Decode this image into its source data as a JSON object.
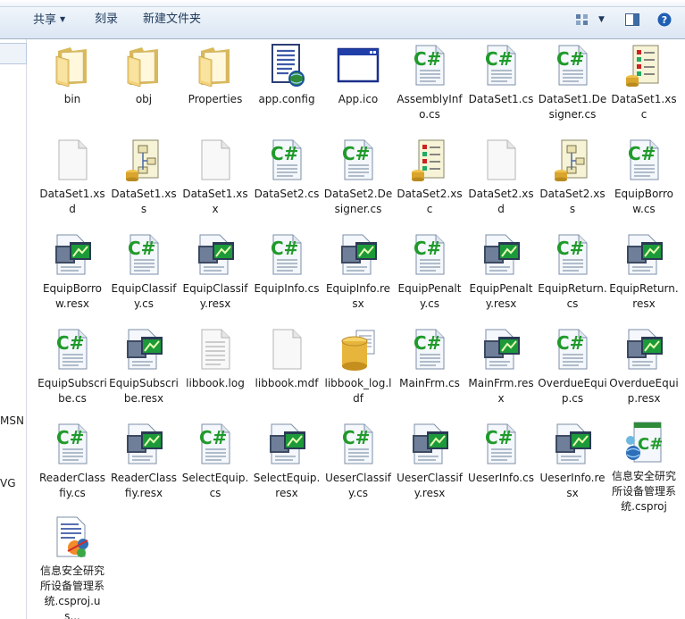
{
  "toolbar": {
    "share_label": "共享",
    "burn_label": "刻录",
    "new_folder_label": "新建文件夹"
  },
  "nav": {
    "items": [
      "MSN",
      "VG"
    ]
  },
  "files": [
    {
      "name": "bin",
      "icon": "folder-icon"
    },
    {
      "name": "obj",
      "icon": "folder-icon"
    },
    {
      "name": "Properties",
      "icon": "folder-icon"
    },
    {
      "name": "app.config",
      "icon": "config-file-icon"
    },
    {
      "name": "App.ico",
      "icon": "ico-file-icon"
    },
    {
      "name": "AssemblyInfo.cs",
      "icon": "csharp-file-icon"
    },
    {
      "name": "DataSet1.cs",
      "icon": "csharp-file-icon"
    },
    {
      "name": "DataSet1.Designer.cs",
      "icon": "csharp-file-icon"
    },
    {
      "name": "DataSet1.xsc",
      "icon": "xsc-file-icon"
    },
    {
      "name": "DataSet1.xsd",
      "icon": "blank-file-icon"
    },
    {
      "name": "DataSet1.xss",
      "icon": "dataset-file-icon"
    },
    {
      "name": "DataSet1.xsx",
      "icon": "blank-file-icon"
    },
    {
      "name": "DataSet2.cs",
      "icon": "csharp-file-icon"
    },
    {
      "name": "DataSet2.Designer.cs",
      "icon": "csharp-file-icon"
    },
    {
      "name": "DataSet2.xsc",
      "icon": "xsc-file-icon"
    },
    {
      "name": "DataSet2.xsd",
      "icon": "blank-file-icon"
    },
    {
      "name": "DataSet2.xss",
      "icon": "dataset-file-icon"
    },
    {
      "name": "EquipBorrow.cs",
      "icon": "csharp-file-icon"
    },
    {
      "name": "EquipBorrow.resx",
      "icon": "resx-file-icon"
    },
    {
      "name": "EquipClassify.cs",
      "icon": "csharp-file-icon"
    },
    {
      "name": "EquipClassify.resx",
      "icon": "resx-file-icon"
    },
    {
      "name": "EquipInfo.cs",
      "icon": "csharp-file-icon"
    },
    {
      "name": "EquipInfo.resx",
      "icon": "resx-file-icon"
    },
    {
      "name": "EquipPenalty.cs",
      "icon": "csharp-file-icon"
    },
    {
      "name": "EquipPenalty.resx",
      "icon": "resx-file-icon"
    },
    {
      "name": "EquipReturn.cs",
      "icon": "csharp-file-icon"
    },
    {
      "name": "EquipReturn.resx",
      "icon": "resx-file-icon"
    },
    {
      "name": "EquipSubscribe.cs",
      "icon": "csharp-file-icon"
    },
    {
      "name": "EquipSubscribe.resx",
      "icon": "resx-file-icon"
    },
    {
      "name": "libbook.log",
      "icon": "log-file-icon"
    },
    {
      "name": "libbook.mdf",
      "icon": "blank-file-icon"
    },
    {
      "name": "libbook_log.ldf",
      "icon": "database-file-icon"
    },
    {
      "name": "MainFrm.cs",
      "icon": "csharp-file-icon"
    },
    {
      "name": "MainFrm.resx",
      "icon": "resx-file-icon"
    },
    {
      "name": "OverdueEquip.cs",
      "icon": "csharp-file-icon"
    },
    {
      "name": "OverdueEquip.resx",
      "icon": "resx-file-icon"
    },
    {
      "name": "ReaderClassfiy.cs",
      "icon": "csharp-file-icon"
    },
    {
      "name": "ReaderClassfiy.resx",
      "icon": "resx-file-icon"
    },
    {
      "name": "SelectEquip.cs",
      "icon": "csharp-file-icon"
    },
    {
      "name": "SelectEquip.resx",
      "icon": "resx-file-icon"
    },
    {
      "name": "UeserClassify.cs",
      "icon": "csharp-file-icon"
    },
    {
      "name": "UeserClassify.resx",
      "icon": "resx-file-icon"
    },
    {
      "name": "UeserInfo.cs",
      "icon": "csharp-file-icon"
    },
    {
      "name": "UeserInfo.resx",
      "icon": "resx-file-icon"
    },
    {
      "name": "信息安全研究所设备管理系统.csproj",
      "icon": "csproj-file-icon"
    },
    {
      "name": "信息安全研究所设备管理系统.csproj.us...",
      "icon": "csproj-user-file-icon"
    }
  ]
}
